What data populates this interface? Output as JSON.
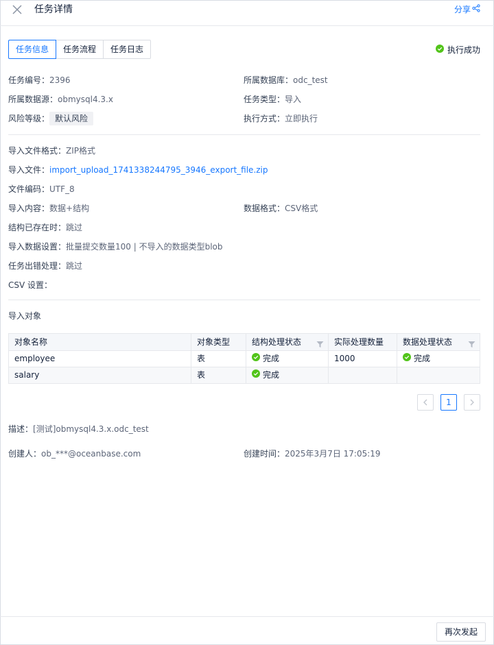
{
  "header": {
    "title": "任务详情",
    "share_label": "分享"
  },
  "tabs": [
    {
      "label": "任务信息",
      "active": true
    },
    {
      "label": "任务流程",
      "active": false
    },
    {
      "label": "任务日志",
      "active": false
    }
  ],
  "status": {
    "label": "执行成功",
    "color": "#52c41a"
  },
  "basic": {
    "task_id": {
      "label": "任务编号：",
      "value": "2396"
    },
    "database": {
      "label": "所属数据库：",
      "value": "odc_test"
    },
    "datasource": {
      "label": "所属数据源：",
      "value": "obmysql4.3.x"
    },
    "task_type": {
      "label": "任务类型：",
      "value": "导入"
    },
    "risk_level": {
      "label": "风险等级：",
      "value": "默认风险"
    },
    "exec_mode": {
      "label": "执行方式：",
      "value": "立即执行"
    }
  },
  "import": {
    "file_format": {
      "label": "导入文件格式：",
      "value": "ZIP格式"
    },
    "file": {
      "label": "导入文件：",
      "value": "import_upload_1741338244795_3946_export_file.zip"
    },
    "encoding": {
      "label": "文件编码：",
      "value": "UTF_8"
    },
    "content": {
      "label": "导入内容：",
      "value": "数据+结构"
    },
    "data_format": {
      "label": "数据格式：",
      "value": "CSV格式"
    },
    "structure_exists": {
      "label": "结构已存在时：",
      "value": "跳过"
    },
    "data_settings": {
      "label": "导入数据设置：",
      "value": "批量提交数量100 | 不导入的数据类型blob"
    },
    "error_handling": {
      "label": "任务出错处理：",
      "value": "跳过"
    },
    "csv_settings": {
      "label": "CSV 设置：",
      "value": ""
    }
  },
  "objects": {
    "title": "导入对象",
    "columns": [
      "对象名称",
      "对象类型",
      "结构处理状态",
      "实际处理数量",
      "数据处理状态"
    ],
    "rows": [
      {
        "name": "employee",
        "type": "表",
        "struct_status": "完成",
        "count": "1000",
        "data_status": "完成"
      },
      {
        "name": "salary",
        "type": "表",
        "struct_status": "完成",
        "count": "",
        "data_status": ""
      }
    ]
  },
  "pagination": {
    "current": "1",
    "prev": "<",
    "next": ">"
  },
  "description": {
    "label": "描述：",
    "value": "[测试]obmysql4.3.x.odc_test"
  },
  "creator": {
    "label": "创建人：",
    "value": "ob_***@oceanbase.com"
  },
  "created_at": {
    "label": "创建时间：",
    "value": "2025年3月7日 17:05:19"
  },
  "footer": {
    "relaunch_label": "再次发起"
  },
  "colors": {
    "accent": "#1677ff",
    "success": "#52c41a",
    "border": "#e6e8ec"
  }
}
